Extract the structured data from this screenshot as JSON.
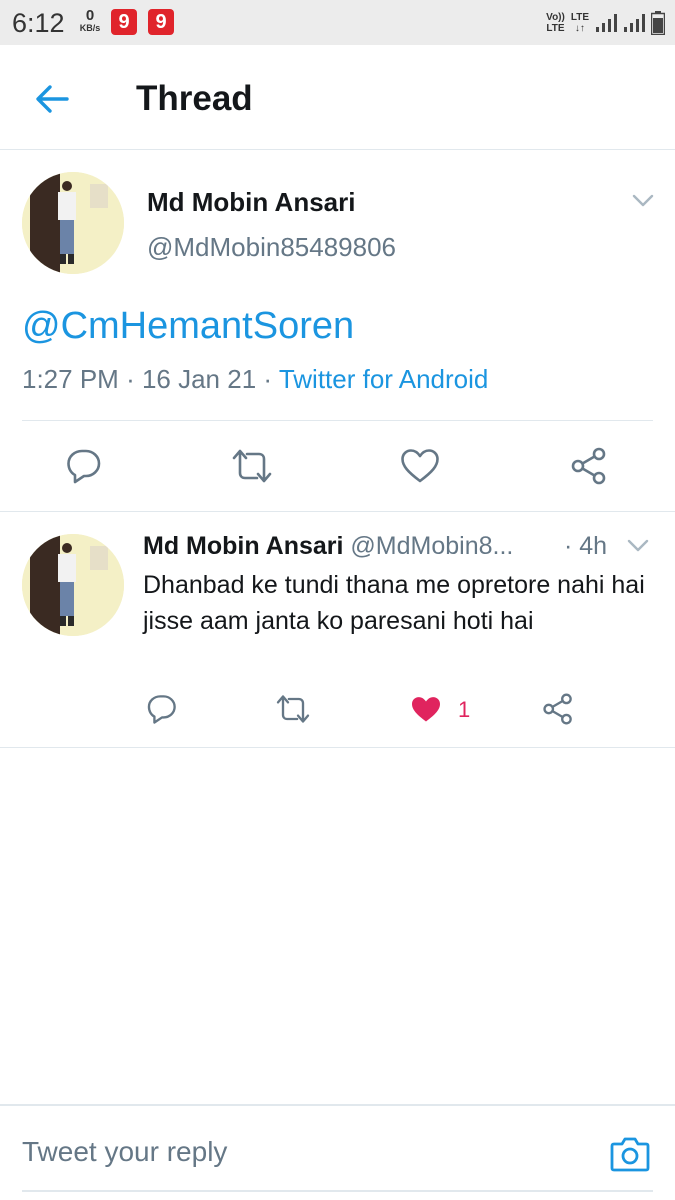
{
  "status_bar": {
    "time": "6:12",
    "net_speed": "0",
    "net_unit": "KB/s",
    "badges": [
      "9",
      "9"
    ],
    "volte_label": "Vo))",
    "lte_label": "LTE",
    "lte2_label": "LTE",
    "icons": [
      "signal-icon",
      "signal-icon",
      "battery-icon"
    ]
  },
  "header": {
    "back_icon": "back-arrow-icon",
    "title": "Thread"
  },
  "main_tweet": {
    "author_name": "Md Mobin Ansari",
    "author_handle": "@MdMobin85489806",
    "text": "@CmHemantSoren",
    "time": "1:27 PM",
    "date": "16 Jan 21",
    "source": "Twitter for Android",
    "actions": [
      "reply-icon",
      "retweet-icon",
      "like-icon",
      "share-icon"
    ]
  },
  "reply_tweet": {
    "author_name": "Md Mobin Ansari",
    "author_handle": "@MdMobin8...",
    "time": "· 4h",
    "text": "Dhanbad ke tundi thana me opretore nahi hai jisse aam janta ko paresani hoti hai",
    "like_count": "1",
    "liked": true
  },
  "composer": {
    "placeholder": "Tweet your reply",
    "camera_icon": "camera-icon"
  },
  "colors": {
    "accent": "#1b95e0",
    "like": "#e0245e",
    "secondary_text": "#657786",
    "border": "#e1e8ed"
  }
}
